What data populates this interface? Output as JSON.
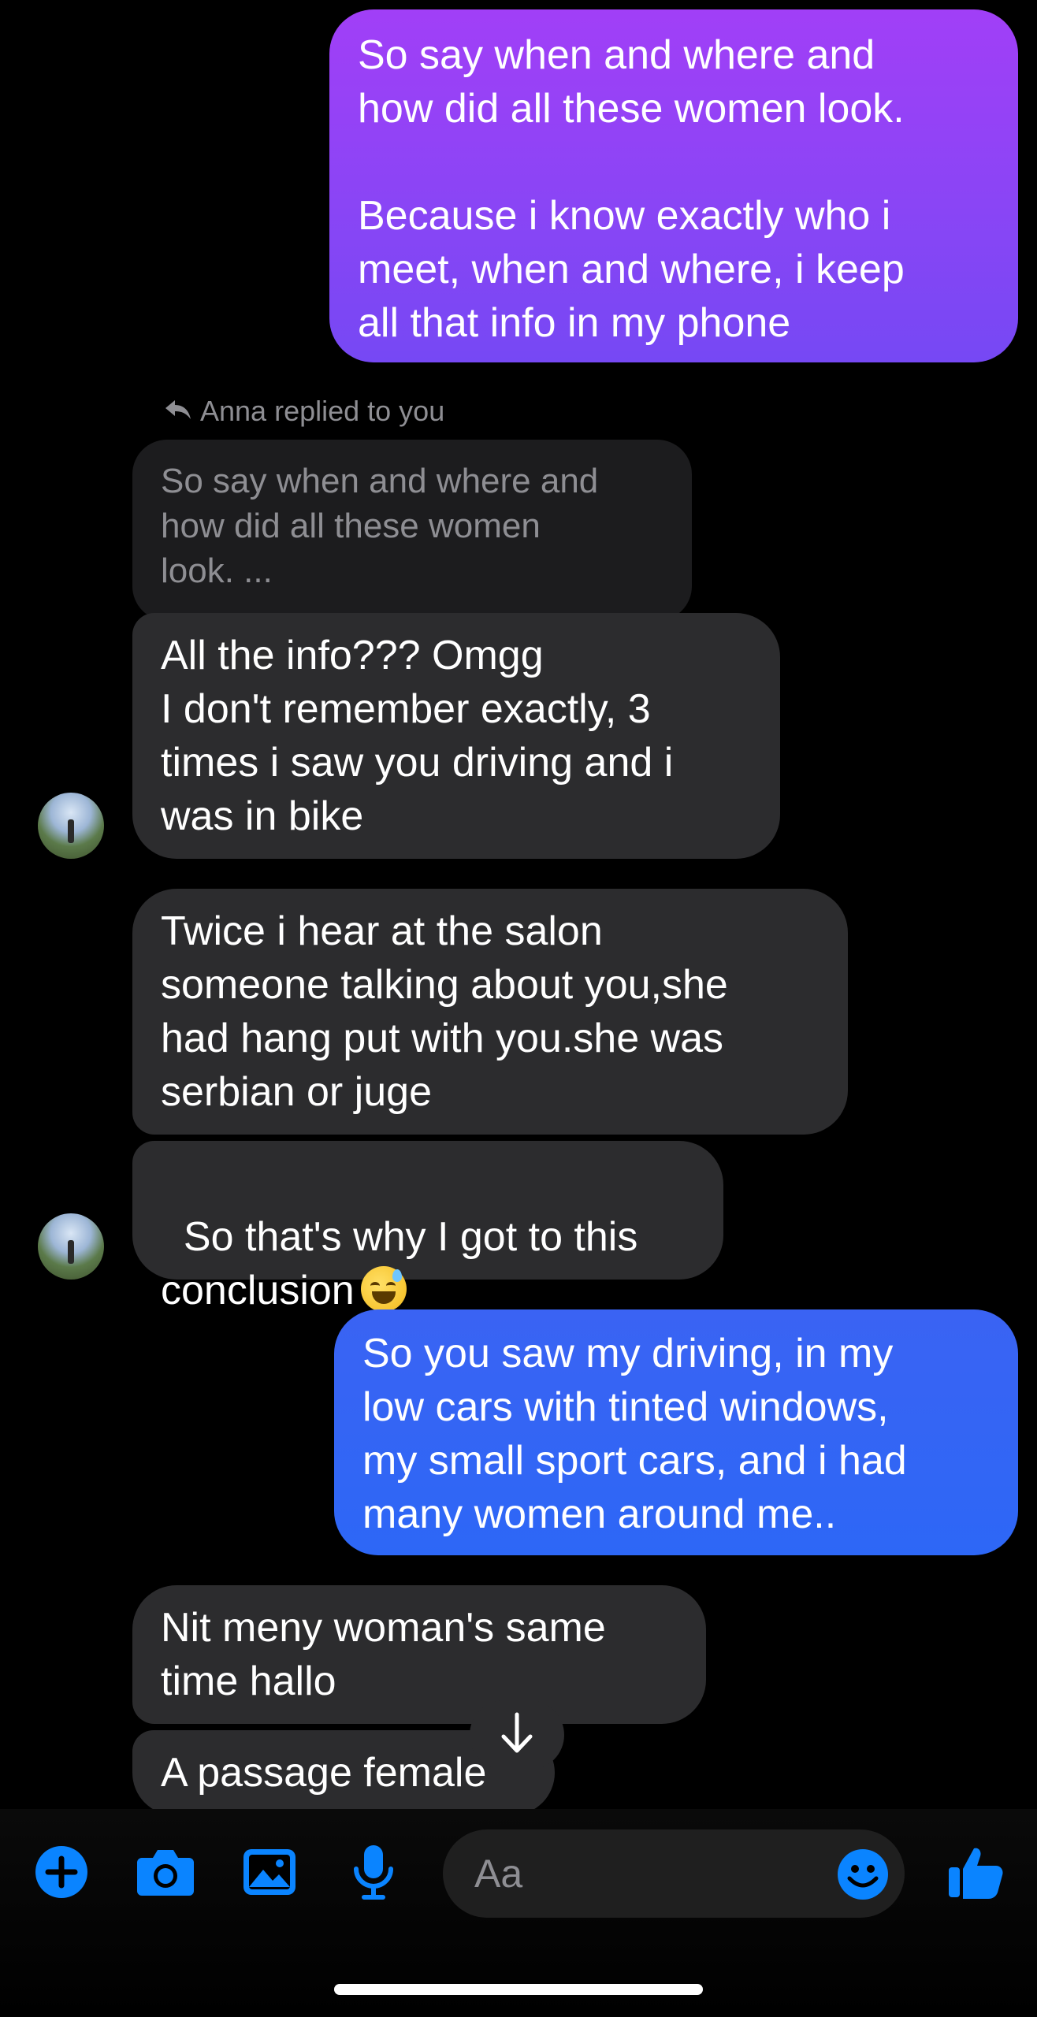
{
  "messages": {
    "m1": "So say when and where and\nhow did all these women look.\n\nBecause i know exactly who i\nmeet, when and where, i keep\nall that info in my phone",
    "reply_note": "Anna replied to you",
    "quote": "So say when and where and\nhow did all these women\nlook. ...",
    "m2": "All the info??? Omgg\nI don't remember exactly, 3\ntimes i saw you driving and i\nwas in bike",
    "m3": "Twice i hear at the salon\nsomeone talking about you,she\nhad hang put with you.she was\nserbian or juge",
    "m4": "So that's why I got to this\nconclusion",
    "m5": "So you saw my driving, in my\nlow cars with tinted windows,\nmy small sport cars, and i had\nmany women around me..",
    "m6": "Nit meny woman's same\ntime hallo",
    "m7": "A passage female"
  },
  "composer": {
    "placeholder": "Aa"
  },
  "colors": {
    "accent": "#0a84ff",
    "received_bubble": "#2c2c2e",
    "sent_purple": "#8a45f5",
    "sent_blue": "#2d67f6"
  },
  "icons": [
    "plus-icon",
    "camera-icon",
    "photo-icon",
    "microphone-icon",
    "smiley-icon",
    "thumbs-up-icon",
    "arrow-down-icon",
    "reply-arrow-icon"
  ]
}
